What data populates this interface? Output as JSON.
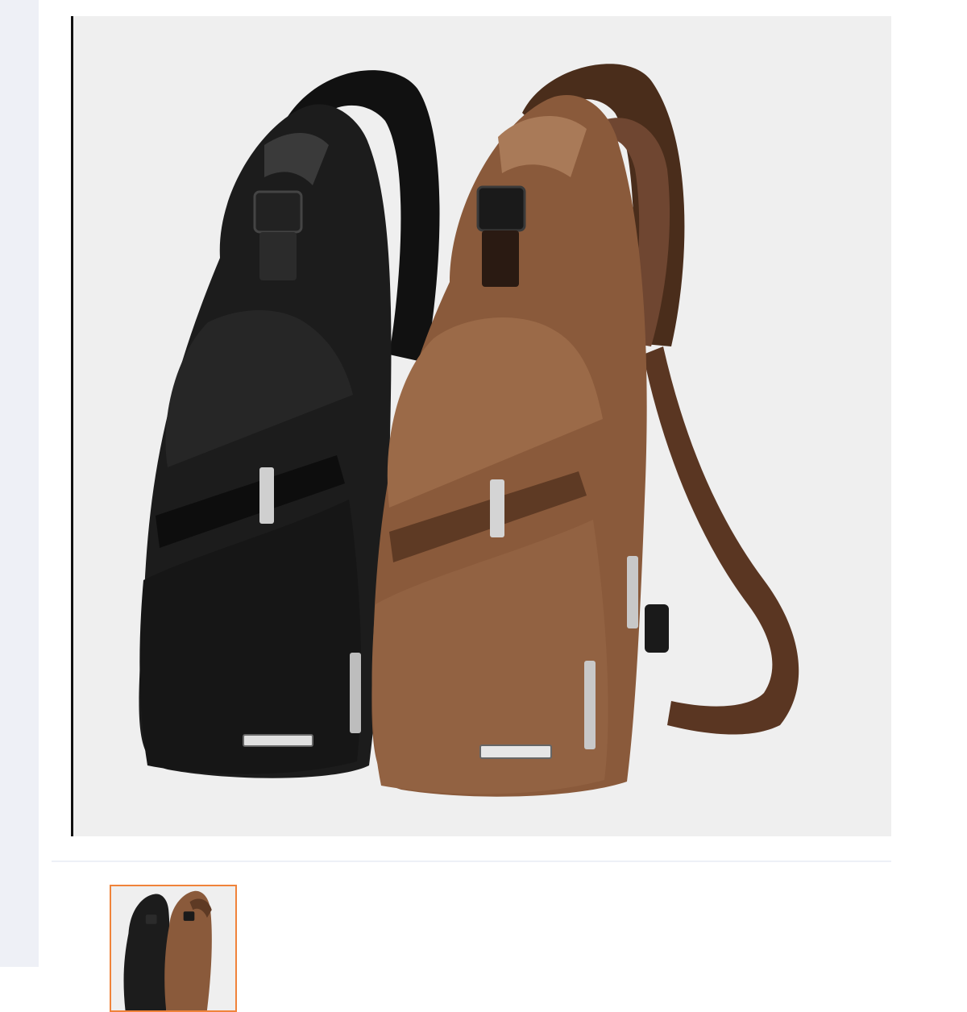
{
  "product_gallery": {
    "main_image": {
      "description": "sling bags",
      "bags": [
        {
          "color_name": "black",
          "body": "#1c1c1c",
          "shade": "#0b0b0b",
          "highlight": "#3a3a3a"
        },
        {
          "color_name": "brown",
          "body": "#8a5a3b",
          "shade": "#5e3a24",
          "highlight": "#a97a58"
        }
      ]
    },
    "thumbnails": [
      {
        "selected": true
      }
    ],
    "colors": {
      "selected_border": "#f0833a",
      "viewer_background": "#efefef",
      "rail": "#eef0f6"
    }
  }
}
